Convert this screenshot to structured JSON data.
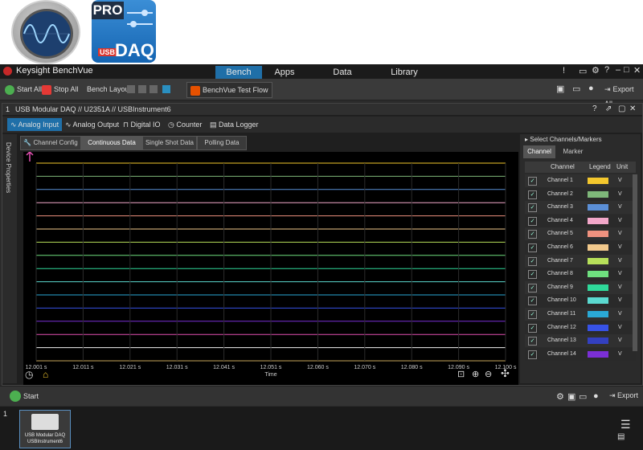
{
  "logos": {
    "daq": {
      "pro": "PRO",
      "usb": "USB",
      "daq": "DAQ"
    }
  },
  "window": {
    "title": "Keysight BenchVue",
    "tabs": [
      "Bench",
      "Apps",
      "Data Manager",
      "Library"
    ],
    "active_tab": "Bench"
  },
  "toolbar": {
    "start_all": "Start All",
    "stop_all": "Stop All",
    "bench_layout": "Bench Layout:",
    "test_flow": "BenchVue Test Flow",
    "export_all": "Export All"
  },
  "panel": {
    "index": "1",
    "title": "USB Modular DAQ // U2351A // USBInstrument6",
    "func_tabs": [
      "Analog Input",
      "Analog Output",
      "Digital IO",
      "Counter",
      "Data Logger"
    ],
    "sub_tabs": [
      "Channel Config",
      "Continuous Data",
      "Single Shot Data",
      "Polling Data"
    ],
    "active_sub_tab": "Continuous Data",
    "sidebar_label": "Device Properties"
  },
  "chart_data": {
    "type": "line",
    "xlabel": "Time",
    "x_ticks": [
      "12.001 s",
      "12.011 s",
      "12.021 s",
      "12.031 s",
      "12.041 s",
      "12.051 s",
      "12.060 s",
      "12.070 s",
      "12.080 s",
      "12.090 s",
      "12.100 s"
    ],
    "series_colors": [
      "#f3c72d",
      "#7fb87a",
      "#5b8fd6",
      "#f2a7c9",
      "#f0927f",
      "#f2c98c",
      "#b7e05a",
      "#6fe07f",
      "#2fd99a",
      "#5bd9d0",
      "#2aa9d6",
      "#3752e6",
      "#7b2fd6",
      "#e04faf",
      "#f2f2f2",
      "#c9a65a"
    ],
    "grid": true
  },
  "channels": {
    "header": "Select Channels/Markers",
    "tabs": [
      "Channel",
      "Marker"
    ],
    "columns": [
      "Channel",
      "Legend",
      "Unit"
    ],
    "rows": [
      {
        "name": "Channel 1",
        "color": "#f3c72d",
        "unit": "V"
      },
      {
        "name": "Channel 2",
        "color": "#7fb87a",
        "unit": "V"
      },
      {
        "name": "Channel 3",
        "color": "#5b8fd6",
        "unit": "V"
      },
      {
        "name": "Channel 4",
        "color": "#f2a7c9",
        "unit": "V"
      },
      {
        "name": "Channel 5",
        "color": "#f0927f",
        "unit": "V"
      },
      {
        "name": "Channel 6",
        "color": "#f2c98c",
        "unit": "V"
      },
      {
        "name": "Channel 7",
        "color": "#b7e05a",
        "unit": "V"
      },
      {
        "name": "Channel 8",
        "color": "#6fe07f",
        "unit": "V"
      },
      {
        "name": "Channel 9",
        "color": "#2fd99a",
        "unit": "V"
      },
      {
        "name": "Channel 10",
        "color": "#5bd9d0",
        "unit": "V"
      },
      {
        "name": "Channel 11",
        "color": "#2aa9d6",
        "unit": "V"
      },
      {
        "name": "Channel 12",
        "color": "#3752e6",
        "unit": "V"
      },
      {
        "name": "Channel 13",
        "color": "#3340c0",
        "unit": "V"
      },
      {
        "name": "Channel 14",
        "color": "#7b2fd6",
        "unit": "V"
      }
    ]
  },
  "bottom": {
    "start": "Start",
    "export": "Export"
  },
  "taskbar": {
    "index": "1",
    "thumb_line1": "USB Modular DAQ",
    "thumb_line2": "USBInstrument6"
  }
}
